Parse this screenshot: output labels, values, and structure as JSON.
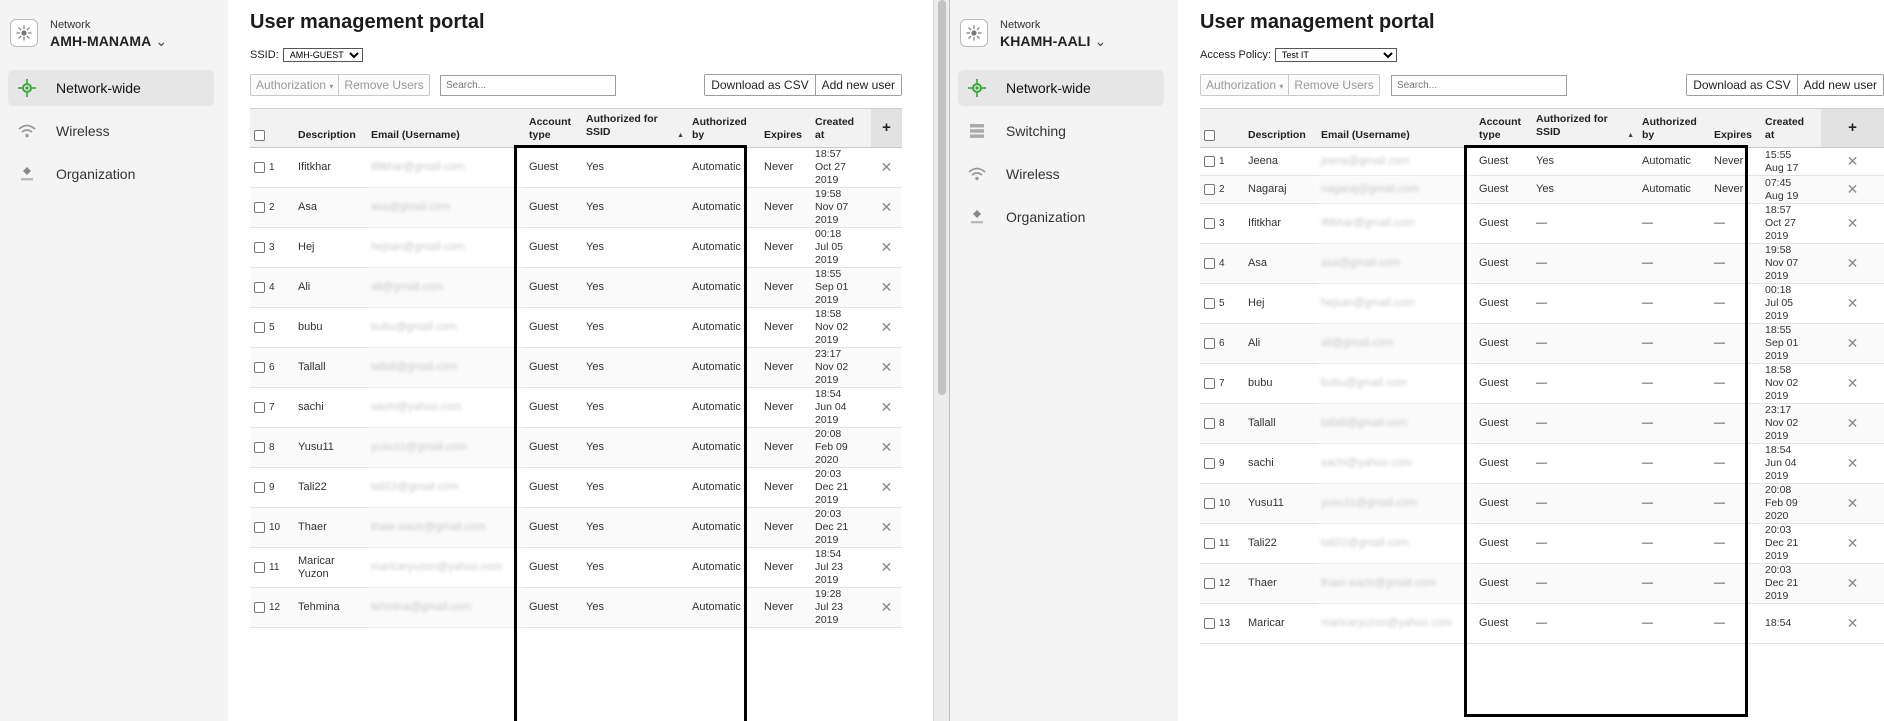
{
  "left": {
    "network_label": "Network",
    "network_name": "AMH-MANAMA",
    "nav": [
      "Network-wide",
      "Wireless",
      "Organization"
    ],
    "page_title": "User management portal",
    "filter_label": "SSID:",
    "filter_value": "AMH-GUEST",
    "toolbar": {
      "authorization": "Authorization",
      "remove_users": "Remove Users",
      "search_placeholder": "Search...",
      "download_csv": "Download as CSV",
      "add_user": "Add new user"
    },
    "columns": {
      "description": "Description",
      "email": "Email (Username)",
      "account_type": [
        "Account",
        "type"
      ],
      "authorized_for": [
        "Authorized for",
        "SSID"
      ],
      "authorized_by": [
        "Authorized",
        "by"
      ],
      "expires": "Expires",
      "created": [
        "Created",
        "at"
      ],
      "add": "+"
    },
    "rows": [
      {
        "n": "1",
        "description": "Ifitkhar",
        "email": "ifitkhar@gmail.com",
        "type": "Guest",
        "auth": "Yes",
        "by": "Automatic",
        "expires": "Never",
        "created": [
          "18:57",
          "Oct 27",
          "2019"
        ]
      },
      {
        "n": "2",
        "description": "Asa",
        "email": "asa@gmail.com",
        "type": "Guest",
        "auth": "Yes",
        "by": "Automatic",
        "expires": "Never",
        "created": [
          "19:58",
          "Nov 07",
          "2019"
        ]
      },
      {
        "n": "3",
        "description": "Hej",
        "email": "hejsan@gmail.com",
        "type": "Guest",
        "auth": "Yes",
        "by": "Automatic",
        "expires": "Never",
        "created": [
          "00:18",
          "Jul 05",
          "2019"
        ]
      },
      {
        "n": "4",
        "description": "Ali",
        "email": "ali@gmail.com",
        "type": "Guest",
        "auth": "Yes",
        "by": "Automatic",
        "expires": "Never",
        "created": [
          "18:55",
          "Sep 01",
          "2019"
        ]
      },
      {
        "n": "5",
        "description": "bubu",
        "email": "bubu@gmail.com",
        "type": "Guest",
        "auth": "Yes",
        "by": "Automatic",
        "expires": "Never",
        "created": [
          "18:58",
          "Nov 02",
          "2019"
        ]
      },
      {
        "n": "6",
        "description": "Tallall",
        "email": "tallall@gmail.com",
        "type": "Guest",
        "auth": "Yes",
        "by": "Automatic",
        "expires": "Never",
        "created": [
          "23:17",
          "Nov 02",
          "2019"
        ]
      },
      {
        "n": "7",
        "description": "sachi",
        "email": "sachi@yahoo.com",
        "type": "Guest",
        "auth": "Yes",
        "by": "Automatic",
        "expires": "Never",
        "created": [
          "18:54",
          "Jun 04",
          "2019"
        ]
      },
      {
        "n": "8",
        "description": "Yusu11",
        "email": "yusu11@gmail.com",
        "type": "Guest",
        "auth": "Yes",
        "by": "Automatic",
        "expires": "Never",
        "created": [
          "20:08",
          "Feb 09",
          "2020"
        ]
      },
      {
        "n": "9",
        "description": "Tali22",
        "email": "tali22@gmail.com",
        "type": "Guest",
        "auth": "Yes",
        "by": "Automatic",
        "expires": "Never",
        "created": [
          "20:03",
          "Dec 21",
          "2019"
        ]
      },
      {
        "n": "10",
        "description": "Thaer",
        "email": "thaer.wazir@gmail.com",
        "type": "Guest",
        "auth": "Yes",
        "by": "Automatic",
        "expires": "Never",
        "created": [
          "20:03",
          "Dec 21",
          "2019"
        ]
      },
      {
        "n": "11",
        "description": "Maricar Yuzon",
        "email": "maricaryuzon@yahoo.com",
        "type": "Guest",
        "auth": "Yes",
        "by": "Automatic",
        "expires": "Never",
        "created": [
          "18:54",
          "Jul 23",
          "2019"
        ]
      },
      {
        "n": "12",
        "description": "Tehmina",
        "email": "tehmina@gmail.com",
        "type": "Guest",
        "auth": "Yes",
        "by": "Automatic",
        "expires": "Never",
        "created": [
          "19:28",
          "Jul 23",
          "2019"
        ]
      }
    ]
  },
  "right": {
    "network_label": "Network",
    "network_name": "KHAMH-AALI",
    "nav": [
      "Network-wide",
      "Switching",
      "Wireless",
      "Organization"
    ],
    "page_title": "User management portal",
    "filter_label": "Access Policy:",
    "filter_value": "Test IT",
    "toolbar": {
      "authorization": "Authorization",
      "remove_users": "Remove Users",
      "search_placeholder": "Search...",
      "download_csv": "Download as CSV",
      "add_user": "Add new user"
    },
    "columns": {
      "description": "Description",
      "email": "Email (Username)",
      "account_type": [
        "Account",
        "type"
      ],
      "authorized_for": [
        "Authorized for",
        "SSID"
      ],
      "authorized_by": [
        "Authorized",
        "by"
      ],
      "expires": "Expires",
      "created": [
        "Created",
        "at"
      ],
      "add": "+"
    },
    "rows": [
      {
        "n": "1",
        "description": "Jeena",
        "email": "jeena@gmail.com",
        "type": "Guest",
        "auth": "Yes",
        "by": "Automatic",
        "expires": "Never",
        "created": [
          "15:55",
          "Aug 17"
        ]
      },
      {
        "n": "2",
        "description": "Nagaraj",
        "email": "nagaraj@gmail.com",
        "type": "Guest",
        "auth": "Yes",
        "by": "Automatic",
        "expires": "Never",
        "created": [
          "07:45",
          "Aug 19"
        ]
      },
      {
        "n": "3",
        "description": "Ifitkhar",
        "email": "ifitkhar@gmail.com",
        "type": "Guest",
        "auth": "—",
        "by": "—",
        "expires": "—",
        "created": [
          "18:57",
          "Oct 27",
          "2019"
        ]
      },
      {
        "n": "4",
        "description": "Asa",
        "email": "asa@gmail.com",
        "type": "Guest",
        "auth": "—",
        "by": "—",
        "expires": "—",
        "created": [
          "19:58",
          "Nov 07",
          "2019"
        ]
      },
      {
        "n": "5",
        "description": "Hej",
        "email": "hejsan@gmail.com",
        "type": "Guest",
        "auth": "—",
        "by": "—",
        "expires": "—",
        "created": [
          "00:18",
          "Jul 05",
          "2019"
        ]
      },
      {
        "n": "6",
        "description": "Ali",
        "email": "ali@gmail.com",
        "type": "Guest",
        "auth": "—",
        "by": "—",
        "expires": "—",
        "created": [
          "18:55",
          "Sep 01",
          "2019"
        ]
      },
      {
        "n": "7",
        "description": "bubu",
        "email": "bubu@gmail.com",
        "type": "Guest",
        "auth": "—",
        "by": "—",
        "expires": "—",
        "created": [
          "18:58",
          "Nov 02",
          "2019"
        ]
      },
      {
        "n": "8",
        "description": "Tallall",
        "email": "tallall@gmail.com",
        "type": "Guest",
        "auth": "—",
        "by": "—",
        "expires": "—",
        "created": [
          "23:17",
          "Nov 02",
          "2019"
        ]
      },
      {
        "n": "9",
        "description": "sachi",
        "email": "sachi@yahoo.com",
        "type": "Guest",
        "auth": "—",
        "by": "—",
        "expires": "—",
        "created": [
          "18:54",
          "Jun 04",
          "2019"
        ]
      },
      {
        "n": "10",
        "description": "Yusu11",
        "email": "yusu11@gmail.com",
        "type": "Guest",
        "auth": "—",
        "by": "—",
        "expires": "—",
        "created": [
          "20:08",
          "Feb 09",
          "2020"
        ]
      },
      {
        "n": "11",
        "description": "Tali22",
        "email": "tali22@gmail.com",
        "type": "Guest",
        "auth": "—",
        "by": "—",
        "expires": "—",
        "created": [
          "20:03",
          "Dec 21",
          "2019"
        ]
      },
      {
        "n": "12",
        "description": "Thaer",
        "email": "thaer.wazir@gmail.com",
        "type": "Guest",
        "auth": "—",
        "by": "—",
        "expires": "—",
        "created": [
          "20:03",
          "Dec 21",
          "2019"
        ]
      },
      {
        "n": "13",
        "description": "Maricar",
        "email": "maricaryuzon@yahoo.com",
        "type": "Guest",
        "auth": "—",
        "by": "—",
        "expires": "—",
        "created": [
          "18:54"
        ]
      }
    ]
  },
  "colors": {
    "sidebar_bg": "#f4f4f4",
    "active_nav_bg": "#e6e6e6",
    "network_wide_icon": "#3aa53a",
    "highlight_border": "#000000"
  },
  "icons": {
    "network_logo": "network-hub-icon",
    "network_wide": "network-wide-icon",
    "switching": "switch-icon",
    "wireless": "wifi-icon",
    "organization": "organization-icon",
    "delete": "close-icon",
    "add_column": "plus-icon"
  }
}
